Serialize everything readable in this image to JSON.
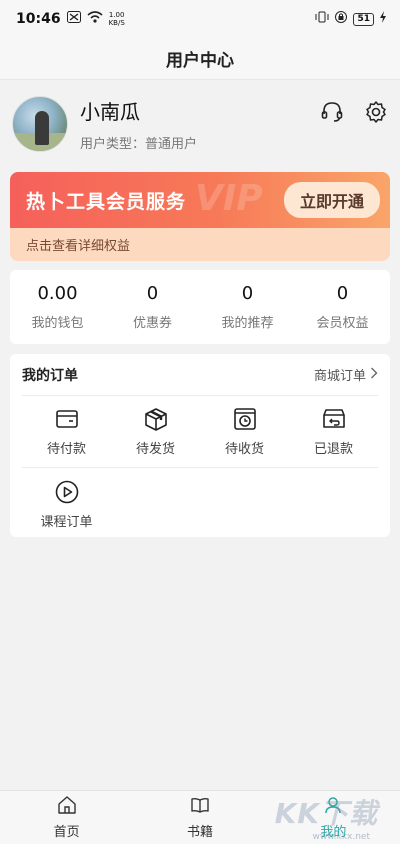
{
  "status_bar": {
    "time": "10:46",
    "net_speed_value": "1.00",
    "net_speed_unit": "KB/S",
    "battery": "51"
  },
  "nav": {
    "title": "用户中心"
  },
  "profile": {
    "name": "小南瓜",
    "user_type": "用户类型：普通用户"
  },
  "vip": {
    "title": "热卜工具会员服务",
    "watermark": "VIP",
    "button_label": "立即开通",
    "detail_link": "点击查看详细权益"
  },
  "stats": [
    {
      "value": "0.00",
      "label": "我的钱包"
    },
    {
      "value": "0",
      "label": "优惠券"
    },
    {
      "value": "0",
      "label": "我的推荐"
    },
    {
      "value": "0",
      "label": "会员权益"
    }
  ],
  "orders": {
    "title": "我的订单",
    "link_label": "商城订单",
    "items": [
      {
        "label": "待付款",
        "icon": "wallet-icon"
      },
      {
        "label": "待发货",
        "icon": "box-icon"
      },
      {
        "label": "待收货",
        "icon": "clock-box-icon"
      },
      {
        "label": "已退款",
        "icon": "refund-icon"
      },
      {
        "label": "课程订单",
        "icon": "play-circle-icon"
      }
    ]
  },
  "tabbar": [
    {
      "label": "首页",
      "icon": "home-icon"
    },
    {
      "label": "书籍",
      "icon": "book-icon"
    },
    {
      "label": "我的",
      "icon": "person-icon",
      "active": true
    }
  ],
  "watermark": {
    "text": "KK下载",
    "url": "www.kkx.net"
  },
  "colors": {
    "accent_tab": "#2ba7a7",
    "vip_gradient_start": "#f5605a",
    "vip_gradient_end": "#f9a56a",
    "vip_button_bg": "#fde7d3"
  }
}
